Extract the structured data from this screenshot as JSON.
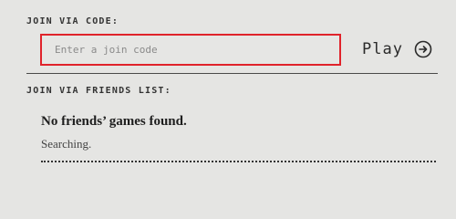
{
  "join_code": {
    "section_label": "JOIN VIA CODE:",
    "input_placeholder": "Enter a join code",
    "input_value": "",
    "play_label": "Play",
    "play_icon": "arrow-right-circle-icon",
    "highlight_color": "#e0232b"
  },
  "friends": {
    "section_label": "JOIN VIA FRIENDS LIST:",
    "empty_title": "No friends’ games found.",
    "status": "Searching."
  }
}
